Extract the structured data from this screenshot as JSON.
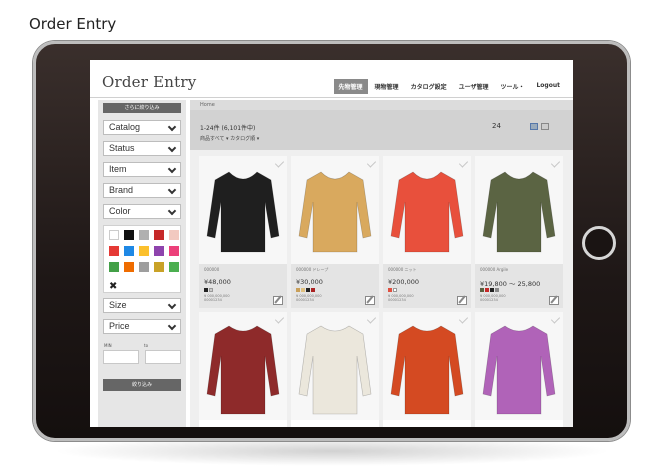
{
  "caption": "Order Entry",
  "app": {
    "title": "Order Entry",
    "nav": [
      {
        "label": "先物管理",
        "active": true
      },
      {
        "label": "現物管理",
        "active": false
      },
      {
        "label": "カタログ設定",
        "active": false
      },
      {
        "label": "ユーザ管理",
        "active": false
      },
      {
        "label": "ツール・",
        "active": false
      },
      {
        "label": "Logout",
        "active": false
      }
    ]
  },
  "sidebar": {
    "refine_top": "さらに絞り込み",
    "filters": {
      "catalog": "Catalog",
      "status": "Status",
      "item": "Item",
      "brand": "Brand",
      "color": "Color",
      "size": "Size",
      "price": "Price"
    },
    "swatch_colors": [
      "#ffffff",
      "#111111",
      "#b0b0b0",
      "#c62828",
      "#f2c9c0",
      "#e53935",
      "#1e88e5",
      "#fbc02d",
      "#8e44ad",
      "#ec407a",
      "#43a047",
      "#ef6c00",
      "#9e9e9e",
      "#c9a227",
      "#4caf50"
    ],
    "clear_icon": "close-icon",
    "min_label": "MIN",
    "max_label": "to",
    "refine_bottom": "絞り込み"
  },
  "content": {
    "breadcrumb": "Home",
    "results_count": "1-24件 (6,101件中)",
    "sort_row": "商品すべて ▾  カタログ順 ▾",
    "per_page": "24"
  },
  "products": [
    {
      "code": "000000",
      "price": "¥48,000",
      "dots": [
        "#222222",
        "#cccccc"
      ],
      "meta": [
        "¥ 000,000,000",
        "00001234"
      ],
      "image_color": "#1f1f1f"
    },
    {
      "code": "000000  ドレープ",
      "price": "¥30,000",
      "dots": [
        "#c9a05a",
        "#e0c080",
        "#222222",
        "#aa2222"
      ],
      "meta": [
        "¥ 000,000,000",
        "00001234"
      ],
      "image_color": "#d9a95e"
    },
    {
      "code": "000000  ニット",
      "price": "¥200,000",
      "dots": [
        "#e05040",
        "#ffffff"
      ],
      "meta": [
        "¥ 000,000,000",
        "00001234"
      ],
      "image_color": "#e8503c"
    },
    {
      "code": "000000  Argile",
      "price": "¥19,800 〜 25,800",
      "dots": [
        "#5a6040",
        "#c62828",
        "#222222",
        "#888888"
      ],
      "meta": [
        "¥ 000,000,000",
        "00001234"
      ],
      "image_color": "#5b6443"
    },
    {
      "code": "",
      "price": "",
      "dots": [],
      "meta": [],
      "image_color": "#8e2a2a"
    },
    {
      "code": "",
      "price": "",
      "dots": [],
      "meta": [],
      "image_color": "#ebe7dc"
    },
    {
      "code": "",
      "price": "",
      "dots": [],
      "meta": [],
      "image_color": "#d44a22"
    },
    {
      "code": "",
      "price": "",
      "dots": [],
      "meta": [],
      "image_color": "#b063b8"
    }
  ]
}
